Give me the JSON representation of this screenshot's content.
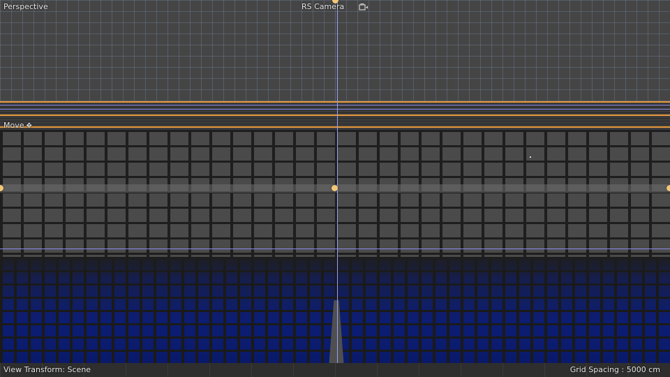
{
  "viewport": {
    "view_name": "Perspective",
    "camera_name": "RS Camera",
    "camera_icon": "camera-lock-icon",
    "tool_label": "Move",
    "tool_icon": "move-icon",
    "view_transform": "View Transform: Scene",
    "grid_spacing": "Grid Spacing : 5000 cm"
  },
  "colors": {
    "horizon_line": "#e89a3c",
    "axis_line": "#9aa0f5",
    "handle": "#f2c777",
    "floor": "#0b1a66"
  }
}
